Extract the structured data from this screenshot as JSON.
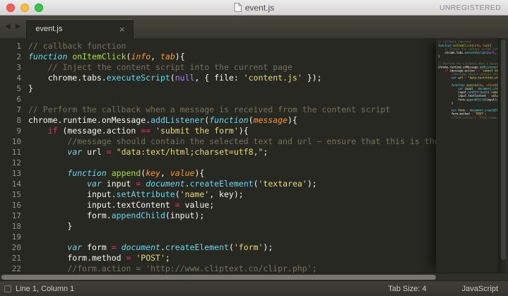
{
  "window": {
    "title": "event.js",
    "registration": "UNREGISTERED"
  },
  "tab_bar": {
    "tabs": [
      {
        "label": "event.js",
        "close": "×",
        "active": true
      }
    ],
    "scroll_left": "◀",
    "scroll_right": "▶"
  },
  "editor": {
    "lines": [
      {
        "n": 1,
        "tokens": [
          [
            "c",
            "// callback function"
          ]
        ]
      },
      {
        "n": 2,
        "tokens": [
          [
            "s",
            "function"
          ],
          [
            "t",
            " "
          ],
          [
            "f",
            "onItemClick"
          ],
          [
            "t",
            "("
          ],
          [
            "p",
            "info"
          ],
          [
            "t",
            ", "
          ],
          [
            "p",
            "tab"
          ],
          [
            "t",
            "){"
          ]
        ]
      },
      {
        "n": 3,
        "tokens": [
          [
            "t",
            "    "
          ],
          [
            "c",
            "// Inject the content script into the current page"
          ]
        ]
      },
      {
        "n": 4,
        "tokens": [
          [
            "t",
            "    chrome.tabs."
          ],
          [
            "sup",
            "executeScript"
          ],
          [
            "t",
            "("
          ],
          [
            "n",
            "null"
          ],
          [
            "t",
            ", { file: "
          ],
          [
            "str",
            "'content.js'"
          ],
          [
            "t",
            " });"
          ]
        ]
      },
      {
        "n": 5,
        "tokens": [
          [
            "t",
            "}"
          ]
        ]
      },
      {
        "n": 6,
        "tokens": []
      },
      {
        "n": 7,
        "tokens": [
          [
            "c",
            "// Perform the callback when a message is received from the content script"
          ]
        ]
      },
      {
        "n": 8,
        "tokens": [
          [
            "t",
            "chrome.runtime.onMessage."
          ],
          [
            "sup",
            "addListener"
          ],
          [
            "t",
            "("
          ],
          [
            "s",
            "function"
          ],
          [
            "t",
            "("
          ],
          [
            "p",
            "message"
          ],
          [
            "t",
            "){"
          ]
        ]
      },
      {
        "n": 9,
        "tokens": [
          [
            "t",
            "    "
          ],
          [
            "k",
            "if"
          ],
          [
            "t",
            " (message.action "
          ],
          [
            "k",
            "=="
          ],
          [
            "t",
            " "
          ],
          [
            "str",
            "'submit the form'"
          ],
          [
            "t",
            "){"
          ]
        ]
      },
      {
        "n": 10,
        "tokens": [
          [
            "t",
            "        "
          ],
          [
            "c",
            "//message should contain the selected text and url – ensure that this is the"
          ]
        ]
      },
      {
        "n": 11,
        "tokens": [
          [
            "t",
            "        "
          ],
          [
            "s",
            "var"
          ],
          [
            "t",
            " url "
          ],
          [
            "k",
            "="
          ],
          [
            "t",
            " "
          ],
          [
            "str",
            "\"data:text/html;charset=utf8,\""
          ],
          [
            "t",
            ";"
          ]
        ]
      },
      {
        "n": 12,
        "tokens": []
      },
      {
        "n": 13,
        "tokens": [
          [
            "t",
            "        "
          ],
          [
            "s",
            "function"
          ],
          [
            "t",
            " "
          ],
          [
            "f",
            "append"
          ],
          [
            "t",
            "("
          ],
          [
            "p",
            "key"
          ],
          [
            "t",
            ", "
          ],
          [
            "p",
            "value"
          ],
          [
            "t",
            "){"
          ]
        ]
      },
      {
        "n": 14,
        "tokens": [
          [
            "t",
            "            "
          ],
          [
            "s",
            "var"
          ],
          [
            "t",
            " input "
          ],
          [
            "k",
            "="
          ],
          [
            "t",
            " "
          ],
          [
            "s",
            "document"
          ],
          [
            "t",
            "."
          ],
          [
            "sup",
            "createElement"
          ],
          [
            "t",
            "("
          ],
          [
            "str",
            "'textarea'"
          ],
          [
            "t",
            ");"
          ]
        ]
      },
      {
        "n": 15,
        "tokens": [
          [
            "t",
            "            input."
          ],
          [
            "sup",
            "setAttribute"
          ],
          [
            "t",
            "("
          ],
          [
            "str",
            "'name'"
          ],
          [
            "t",
            ", key);"
          ]
        ]
      },
      {
        "n": 16,
        "tokens": [
          [
            "t",
            "            input.textContent "
          ],
          [
            "k",
            "="
          ],
          [
            "t",
            " value;"
          ]
        ]
      },
      {
        "n": 17,
        "tokens": [
          [
            "t",
            "            form."
          ],
          [
            "sup",
            "appendChild"
          ],
          [
            "t",
            "(input);"
          ]
        ]
      },
      {
        "n": 18,
        "tokens": [
          [
            "t",
            "        }"
          ]
        ]
      },
      {
        "n": 19,
        "tokens": []
      },
      {
        "n": 20,
        "tokens": [
          [
            "t",
            "        "
          ],
          [
            "s",
            "var"
          ],
          [
            "t",
            " form "
          ],
          [
            "k",
            "="
          ],
          [
            "t",
            " "
          ],
          [
            "s",
            "document"
          ],
          [
            "t",
            "."
          ],
          [
            "sup",
            "createElement"
          ],
          [
            "t",
            "("
          ],
          [
            "str",
            "'form'"
          ],
          [
            "t",
            ");"
          ]
        ]
      },
      {
        "n": 21,
        "tokens": [
          [
            "t",
            "        form.method "
          ],
          [
            "k",
            "="
          ],
          [
            "t",
            " "
          ],
          [
            "str",
            "'POST'"
          ],
          [
            "t",
            ";"
          ]
        ]
      },
      {
        "n": 22,
        "tokens": [
          [
            "t",
            "        "
          ],
          [
            "c",
            "//form.action = 'http://www.cliptext.co/clipr.php';"
          ]
        ]
      }
    ]
  },
  "status_bar": {
    "caret": "Line 1, Column 1",
    "tab_size": "Tab Size: 4",
    "syntax": "JavaScript"
  },
  "colors": {
    "editor_bg": "#272822",
    "comment": "#75715E",
    "keyword": "#F92672",
    "storage": "#66D9EF",
    "function_name": "#A6E22E",
    "parameter": "#FD971F",
    "string": "#E6DB74",
    "constant": "#AE81FF",
    "plain_text": "#F8F8F2",
    "gutter_text": "#8F908A",
    "traffic_red": "#FC5B57",
    "traffic_yellow": "#FDBE3F",
    "traffic_green": "#34C84A"
  }
}
